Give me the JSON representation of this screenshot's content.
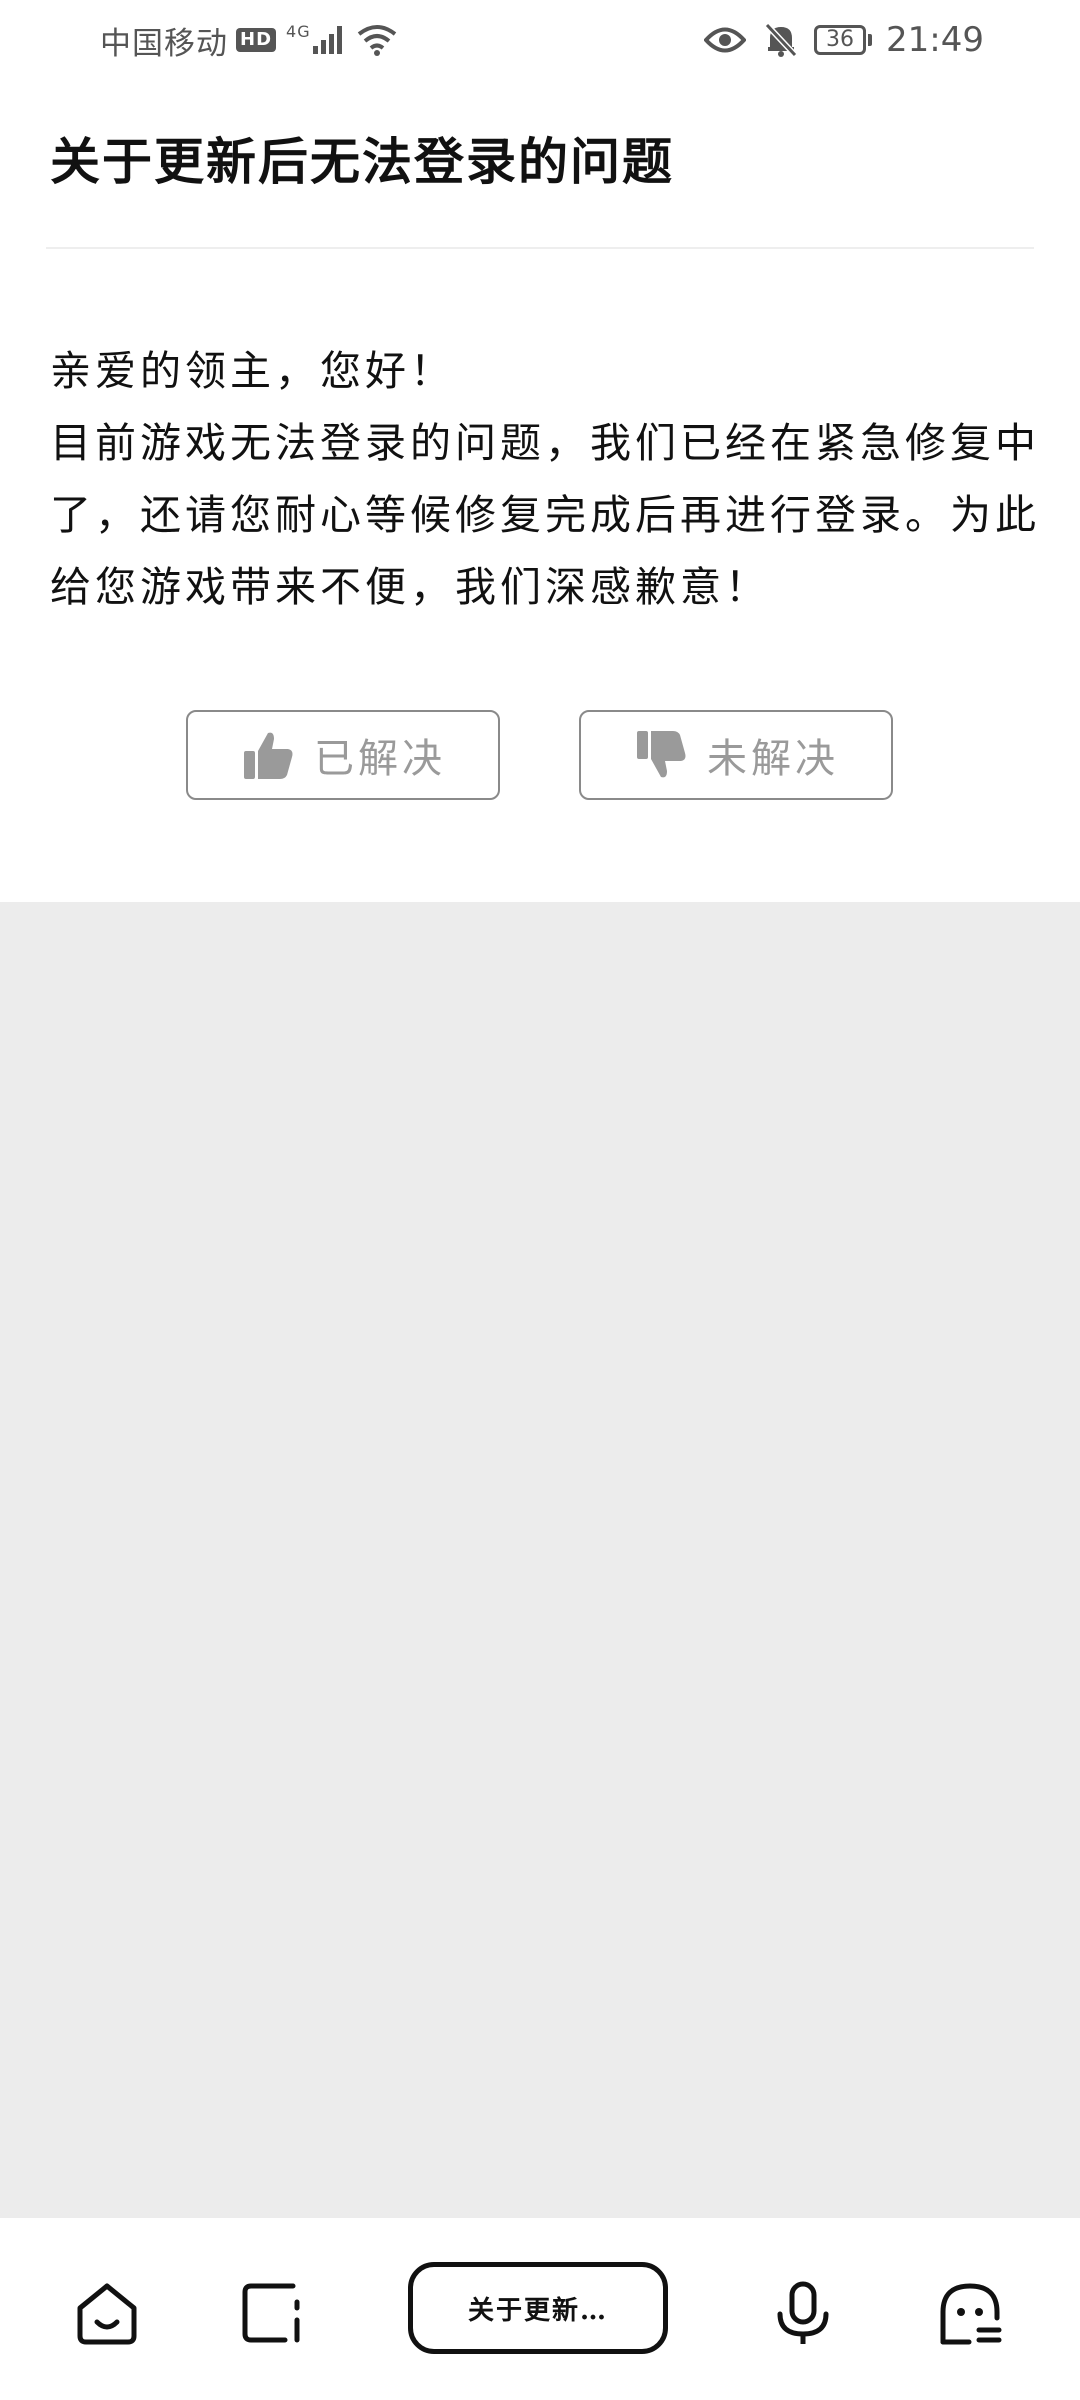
{
  "status_bar": {
    "carrier": "中国移动",
    "hd_badge": "HD",
    "network_type": "4G",
    "battery_level": "36",
    "time": "21:49"
  },
  "article": {
    "title": "关于更新后无法登录的问题",
    "greeting": "亲爱的领主，您好！",
    "body": "目前游戏无法登录的问题，我们已经在紧急修复中了，还请您耐心等候修复完成后再进行登录。为此给您游戏带来不便，我们深感歉意！"
  },
  "feedback": {
    "solved_label": "已解决",
    "unsolved_label": "未解决"
  },
  "bottom_nav": {
    "current_page_label": "关于更新…"
  },
  "icons": {
    "home": "home-icon",
    "square": "square-icon",
    "mic": "microphone-icon",
    "bot": "assistant-icon",
    "thumbs_up": "thumbs-up-icon",
    "thumbs_down": "thumbs-down-icon"
  },
  "colors": {
    "text_primary": "#111111",
    "text_muted": "#9a9a9a",
    "background_grey": "#ececec"
  }
}
